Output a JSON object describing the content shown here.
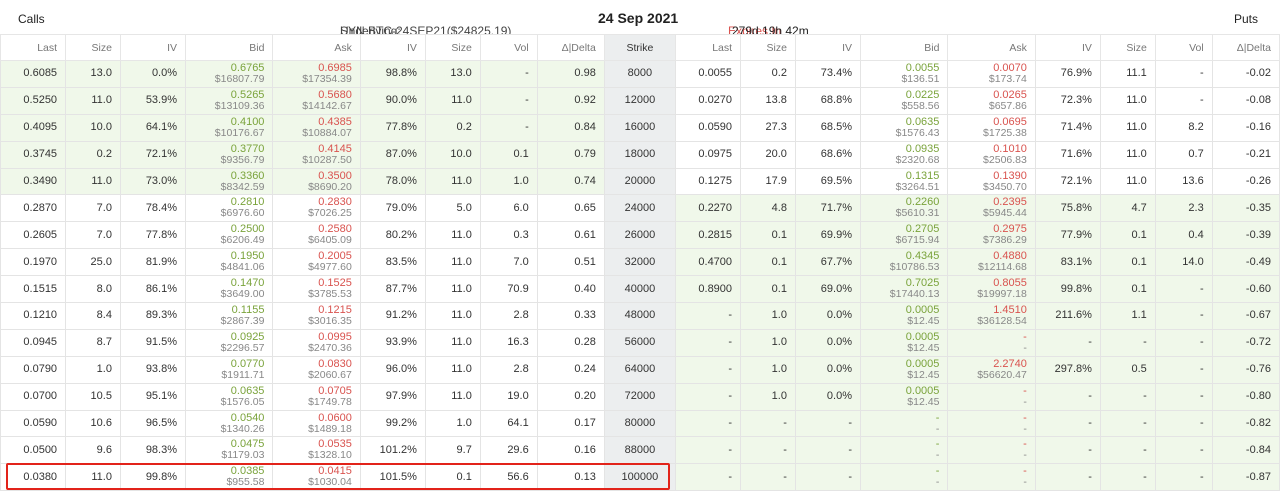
{
  "header": {
    "calls": "Calls",
    "underlying_label": "Underlying:",
    "underlying_value": "SYN.BTC-24SEP21($24825.19)",
    "date": "24 Sep 2021",
    "expires_label": "Expires In",
    "expires_value": "279d 19h 42m",
    "puts": "Puts"
  },
  "columns": {
    "call": [
      "Last",
      "Size",
      "IV",
      "Bid",
      "Ask",
      "IV",
      "Size",
      "Vol",
      "Δ|Delta"
    ],
    "strike": "Strike",
    "put": [
      "Last",
      "Size",
      "IV",
      "Bid",
      "Ask",
      "IV",
      "Size",
      "Vol",
      "Δ|Delta"
    ]
  },
  "rows": [
    {
      "strike": "8000",
      "itm_call": true,
      "itm_put": false,
      "call": {
        "last": "0.6085",
        "size": "13.0",
        "iv": "0.0%",
        "bid": "0.6765",
        "bid_usd": "$16807.79",
        "ask": "0.6985",
        "ask_usd": "$17354.39",
        "ask_iv": "98.8%",
        "ask_size": "13.0",
        "vol": "-",
        "delta": "0.98"
      },
      "put": {
        "last": "0.0055",
        "size": "0.2",
        "iv": "73.4%",
        "bid": "0.0055",
        "bid_usd": "$136.51",
        "ask": "0.0070",
        "ask_usd": "$173.74",
        "ask_iv": "76.9%",
        "ask_size": "11.1",
        "vol": "-",
        "delta": "-0.02"
      }
    },
    {
      "strike": "12000",
      "itm_call": true,
      "itm_put": false,
      "call": {
        "last": "0.5250",
        "size": "11.0",
        "iv": "53.9%",
        "bid": "0.5265",
        "bid_usd": "$13109.36",
        "ask": "0.5680",
        "ask_usd": "$14142.67",
        "ask_iv": "90.0%",
        "ask_size": "11.0",
        "vol": "-",
        "delta": "0.92"
      },
      "put": {
        "last": "0.0270",
        "size": "13.8",
        "iv": "68.8%",
        "bid": "0.0225",
        "bid_usd": "$558.56",
        "ask": "0.0265",
        "ask_usd": "$657.86",
        "ask_iv": "72.3%",
        "ask_size": "11.0",
        "vol": "-",
        "delta": "-0.08"
      }
    },
    {
      "strike": "16000",
      "itm_call": true,
      "itm_put": false,
      "call": {
        "last": "0.4095",
        "size": "10.0",
        "iv": "64.1%",
        "bid": "0.4100",
        "bid_usd": "$10176.67",
        "ask": "0.4385",
        "ask_usd": "$10884.07",
        "ask_iv": "77.8%",
        "ask_size": "0.2",
        "vol": "-",
        "delta": "0.84"
      },
      "put": {
        "last": "0.0590",
        "size": "27.3",
        "iv": "68.5%",
        "bid": "0.0635",
        "bid_usd": "$1576.43",
        "ask": "0.0695",
        "ask_usd": "$1725.38",
        "ask_iv": "71.4%",
        "ask_size": "11.0",
        "vol": "8.2",
        "delta": "-0.16"
      }
    },
    {
      "strike": "18000",
      "itm_call": true,
      "itm_put": false,
      "call": {
        "last": "0.3745",
        "size": "0.2",
        "iv": "72.1%",
        "bid": "0.3770",
        "bid_usd": "$9356.79",
        "ask": "0.4145",
        "ask_usd": "$10287.50",
        "ask_iv": "87.0%",
        "ask_size": "10.0",
        "vol": "0.1",
        "delta": "0.79"
      },
      "put": {
        "last": "0.0975",
        "size": "20.0",
        "iv": "68.6%",
        "bid": "0.0935",
        "bid_usd": "$2320.68",
        "ask": "0.1010",
        "ask_usd": "$2506.83",
        "ask_iv": "71.6%",
        "ask_size": "11.0",
        "vol": "0.7",
        "delta": "-0.21"
      }
    },
    {
      "strike": "20000",
      "itm_call": true,
      "itm_put": false,
      "call": {
        "last": "0.3490",
        "size": "11.0",
        "iv": "73.0%",
        "bid": "0.3360",
        "bid_usd": "$8342.59",
        "ask": "0.3500",
        "ask_usd": "$8690.20",
        "ask_iv": "78.0%",
        "ask_size": "11.0",
        "vol": "1.0",
        "delta": "0.74"
      },
      "put": {
        "last": "0.1275",
        "size": "17.9",
        "iv": "69.5%",
        "bid": "0.1315",
        "bid_usd": "$3264.51",
        "ask": "0.1390",
        "ask_usd": "$3450.70",
        "ask_iv": "72.1%",
        "ask_size": "11.0",
        "vol": "13.6",
        "delta": "-0.26"
      }
    },
    {
      "strike": "24000",
      "itm_call": false,
      "itm_put": true,
      "call": {
        "last": "0.2870",
        "size": "7.0",
        "iv": "78.4%",
        "bid": "0.2810",
        "bid_usd": "$6976.60",
        "ask": "0.2830",
        "ask_usd": "$7026.25",
        "ask_iv": "79.0%",
        "ask_size": "5.0",
        "vol": "6.0",
        "delta": "0.65"
      },
      "put": {
        "last": "0.2270",
        "size": "4.8",
        "iv": "71.7%",
        "bid": "0.2260",
        "bid_usd": "$5610.31",
        "ask": "0.2395",
        "ask_usd": "$5945.44",
        "ask_iv": "75.8%",
        "ask_size": "4.7",
        "vol": "2.3",
        "delta": "-0.35"
      }
    },
    {
      "strike": "26000",
      "itm_call": false,
      "itm_put": true,
      "call": {
        "last": "0.2605",
        "size": "7.0",
        "iv": "77.8%",
        "bid": "0.2500",
        "bid_usd": "$6206.49",
        "ask": "0.2580",
        "ask_usd": "$6405.09",
        "ask_iv": "80.2%",
        "ask_size": "11.0",
        "vol": "0.3",
        "delta": "0.61"
      },
      "put": {
        "last": "0.2815",
        "size": "0.1",
        "iv": "69.9%",
        "bid": "0.2705",
        "bid_usd": "$6715.94",
        "ask": "0.2975",
        "ask_usd": "$7386.29",
        "ask_iv": "77.9%",
        "ask_size": "0.1",
        "vol": "0.4",
        "delta": "-0.39"
      }
    },
    {
      "strike": "32000",
      "itm_call": false,
      "itm_put": true,
      "call": {
        "last": "0.1970",
        "size": "25.0",
        "iv": "81.9%",
        "bid": "0.1950",
        "bid_usd": "$4841.06",
        "ask": "0.2005",
        "ask_usd": "$4977.60",
        "ask_iv": "83.5%",
        "ask_size": "11.0",
        "vol": "7.0",
        "delta": "0.51"
      },
      "put": {
        "last": "0.4700",
        "size": "0.1",
        "iv": "67.7%",
        "bid": "0.4345",
        "bid_usd": "$10786.53",
        "ask": "0.4880",
        "ask_usd": "$12114.68",
        "ask_iv": "83.1%",
        "ask_size": "0.1",
        "vol": "14.0",
        "delta": "-0.49"
      }
    },
    {
      "strike": "40000",
      "itm_call": false,
      "itm_put": true,
      "call": {
        "last": "0.1515",
        "size": "8.0",
        "iv": "86.1%",
        "bid": "0.1470",
        "bid_usd": "$3649.00",
        "ask": "0.1525",
        "ask_usd": "$3785.53",
        "ask_iv": "87.7%",
        "ask_size": "11.0",
        "vol": "70.9",
        "delta": "0.40"
      },
      "put": {
        "last": "0.8900",
        "size": "0.1",
        "iv": "69.0%",
        "bid": "0.7025",
        "bid_usd": "$17440.13",
        "ask": "0.8055",
        "ask_usd": "$19997.18",
        "ask_iv": "99.8%",
        "ask_size": "0.1",
        "vol": "-",
        "delta": "-0.60"
      }
    },
    {
      "strike": "48000",
      "itm_call": false,
      "itm_put": true,
      "call": {
        "last": "0.1210",
        "size": "8.4",
        "iv": "89.3%",
        "bid": "0.1155",
        "bid_usd": "$2867.39",
        "ask": "0.1215",
        "ask_usd": "$3016.35",
        "ask_iv": "91.2%",
        "ask_size": "11.0",
        "vol": "2.8",
        "delta": "0.33"
      },
      "put": {
        "last": "-",
        "size": "1.0",
        "iv": "0.0%",
        "bid": "0.0005",
        "bid_usd": "$12.45",
        "ask": "1.4510",
        "ask_usd": "$36128.54",
        "ask_iv": "211.6%",
        "ask_size": "1.1",
        "vol": "-",
        "delta": "-0.67"
      }
    },
    {
      "strike": "56000",
      "itm_call": false,
      "itm_put": true,
      "call": {
        "last": "0.0945",
        "size": "8.7",
        "iv": "91.5%",
        "bid": "0.0925",
        "bid_usd": "$2296.57",
        "ask": "0.0995",
        "ask_usd": "$2470.36",
        "ask_iv": "93.9%",
        "ask_size": "11.0",
        "vol": "16.3",
        "delta": "0.28"
      },
      "put": {
        "last": "-",
        "size": "1.0",
        "iv": "0.0%",
        "bid": "0.0005",
        "bid_usd": "$12.45",
        "ask": "-",
        "ask_usd": "-",
        "ask_iv": "-",
        "ask_size": "-",
        "vol": "-",
        "delta": "-0.72"
      }
    },
    {
      "strike": "64000",
      "itm_call": false,
      "itm_put": true,
      "call": {
        "last": "0.0790",
        "size": "1.0",
        "iv": "93.8%",
        "bid": "0.0770",
        "bid_usd": "$1911.71",
        "ask": "0.0830",
        "ask_usd": "$2060.67",
        "ask_iv": "96.0%",
        "ask_size": "11.0",
        "vol": "2.8",
        "delta": "0.24"
      },
      "put": {
        "last": "-",
        "size": "1.0",
        "iv": "0.0%",
        "bid": "0.0005",
        "bid_usd": "$12.45",
        "ask": "2.2740",
        "ask_usd": "$56620.47",
        "ask_iv": "297.8%",
        "ask_size": "0.5",
        "vol": "-",
        "delta": "-0.76"
      }
    },
    {
      "strike": "72000",
      "itm_call": false,
      "itm_put": true,
      "call": {
        "last": "0.0700",
        "size": "10.5",
        "iv": "95.1%",
        "bid": "0.0635",
        "bid_usd": "$1576.05",
        "ask": "0.0705",
        "ask_usd": "$1749.78",
        "ask_iv": "97.9%",
        "ask_size": "11.0",
        "vol": "19.0",
        "delta": "0.20"
      },
      "put": {
        "last": "-",
        "size": "1.0",
        "iv": "0.0%",
        "bid": "0.0005",
        "bid_usd": "$12.45",
        "ask": "-",
        "ask_usd": "-",
        "ask_iv": "-",
        "ask_size": "-",
        "vol": "-",
        "delta": "-0.80"
      }
    },
    {
      "strike": "80000",
      "itm_call": false,
      "itm_put": true,
      "call": {
        "last": "0.0590",
        "size": "10.6",
        "iv": "96.5%",
        "bid": "0.0540",
        "bid_usd": "$1340.26",
        "ask": "0.0600",
        "ask_usd": "$1489.18",
        "ask_iv": "99.2%",
        "ask_size": "1.0",
        "vol": "64.1",
        "delta": "0.17"
      },
      "put": {
        "last": "-",
        "size": "-",
        "iv": "-",
        "bid": "-",
        "bid_usd": "-",
        "ask": "-",
        "ask_usd": "-",
        "ask_iv": "-",
        "ask_size": "-",
        "vol": "-",
        "delta": "-0.82"
      }
    },
    {
      "strike": "88000",
      "itm_call": false,
      "itm_put": true,
      "call": {
        "last": "0.0500",
        "size": "9.6",
        "iv": "98.3%",
        "bid": "0.0475",
        "bid_usd": "$1179.03",
        "ask": "0.0535",
        "ask_usd": "$1328.10",
        "ask_iv": "101.2%",
        "ask_size": "9.7",
        "vol": "29.6",
        "delta": "0.16"
      },
      "put": {
        "last": "-",
        "size": "-",
        "iv": "-",
        "bid": "-",
        "bid_usd": "-",
        "ask": "-",
        "ask_usd": "-",
        "ask_iv": "-",
        "ask_size": "-",
        "vol": "-",
        "delta": "-0.84"
      }
    },
    {
      "strike": "100000",
      "itm_call": false,
      "itm_put": true,
      "call": {
        "last": "0.0380",
        "size": "11.0",
        "iv": "99.8%",
        "bid": "0.0385",
        "bid_usd": "$955.58",
        "ask": "0.0415",
        "ask_usd": "$1030.04",
        "ask_iv": "101.5%",
        "ask_size": "0.1",
        "vol": "56.6",
        "delta": "0.13"
      },
      "put": {
        "last": "-",
        "size": "-",
        "iv": "-",
        "bid": "-",
        "bid_usd": "-",
        "ask": "-",
        "ask_usd": "-",
        "ask_iv": "-",
        "ask_size": "-",
        "vol": "-",
        "delta": "-0.87"
      }
    }
  ]
}
